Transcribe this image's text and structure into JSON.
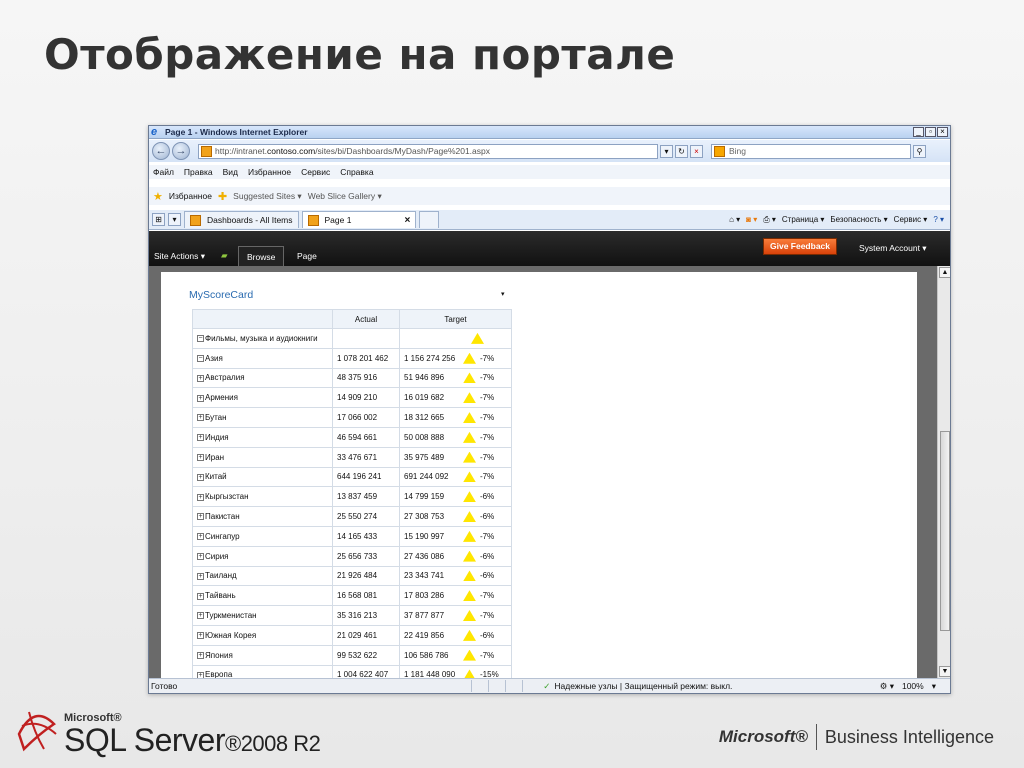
{
  "slide": {
    "title": "Отображение на портале"
  },
  "browser": {
    "window_title": "Page 1 - Windows Internet Explorer",
    "url_prefix": "http://intranet.",
    "url_domain": "contoso.com",
    "url_rest": "/sites/bi/Dashboards/MyDash/Page%201.aspx",
    "search_placeholder": "Bing",
    "menu": [
      "Файл",
      "Правка",
      "Вид",
      "Избранное",
      "Сервис",
      "Справка"
    ],
    "favorites_label": "Избранное",
    "favorites_links": [
      "Suggested Sites ▾",
      "Web Slice Gallery ▾"
    ],
    "tabs": [
      {
        "label": "Dashboards - All Items"
      },
      {
        "label": "Page 1"
      }
    ],
    "command_bar": [
      "Страница ▾",
      "Безопасность ▾",
      "Сервис ▾"
    ],
    "status_text": "Готово",
    "status_zone": "Надежные узлы | Защищенный режим: выкл.",
    "zoom": "100%"
  },
  "sharepoint": {
    "site_actions": "Site Actions ▾",
    "tab_browse": "Browse",
    "tab_page": "Page",
    "give_feedback": "Give Feedback",
    "system_account": "System Account ▾",
    "webpart_title": "MyScoreCard"
  },
  "scorecard": {
    "headers": [
      "",
      "Actual",
      "Target"
    ],
    "rows": [
      {
        "name": "Фильмы, музыка и аудиокниги",
        "actual": "",
        "target": "",
        "pct": "",
        "level": 1,
        "sign": "−"
      },
      {
        "name": "Азия",
        "actual": "1 078 201 462",
        "target": "1 156 274 256",
        "pct": "-7%",
        "level": 2,
        "sign": "−"
      },
      {
        "name": "Австралия",
        "actual": "48 375 916",
        "target": "51 946 896",
        "pct": "-7%",
        "level": 3,
        "sign": "+"
      },
      {
        "name": "Армения",
        "actual": "14 909 210",
        "target": "16 019 682",
        "pct": "-7%",
        "level": 3,
        "sign": "+"
      },
      {
        "name": "Бутан",
        "actual": "17 066 002",
        "target": "18 312 665",
        "pct": "-7%",
        "level": 3,
        "sign": "+"
      },
      {
        "name": "Индия",
        "actual": "46 594 661",
        "target": "50 008 888",
        "pct": "-7%",
        "level": 3,
        "sign": "+"
      },
      {
        "name": "Иран",
        "actual": "33 476 671",
        "target": "35 975 489",
        "pct": "-7%",
        "level": 3,
        "sign": "+"
      },
      {
        "name": "Китай",
        "actual": "644 196 241",
        "target": "691 244 092",
        "pct": "-7%",
        "level": 3,
        "sign": "+"
      },
      {
        "name": "Кыргызстан",
        "actual": "13 837 459",
        "target": "14 799 159",
        "pct": "-6%",
        "level": 3,
        "sign": "+"
      },
      {
        "name": "Пакистан",
        "actual": "25 550 274",
        "target": "27 308 753",
        "pct": "-6%",
        "level": 3,
        "sign": "+"
      },
      {
        "name": "Сингапур",
        "actual": "14 165 433",
        "target": "15 190 997",
        "pct": "-7%",
        "level": 3,
        "sign": "+"
      },
      {
        "name": "Сирия",
        "actual": "25 656 733",
        "target": "27 436 086",
        "pct": "-6%",
        "level": 3,
        "sign": "+"
      },
      {
        "name": "Таиланд",
        "actual": "21 926 484",
        "target": "23 343 741",
        "pct": "-6%",
        "level": 3,
        "sign": "+"
      },
      {
        "name": "Тайвань",
        "actual": "16 568 081",
        "target": "17 803 286",
        "pct": "-7%",
        "level": 3,
        "sign": "+"
      },
      {
        "name": "Туркменистан",
        "actual": "35 316 213",
        "target": "37 877 877",
        "pct": "-7%",
        "level": 3,
        "sign": "+"
      },
      {
        "name": "Южная Корея",
        "actual": "21 029 461",
        "target": "22 419 856",
        "pct": "-6%",
        "level": 3,
        "sign": "+"
      },
      {
        "name": "Япония",
        "actual": "99 532 622",
        "target": "106 586 786",
        "pct": "-7%",
        "level": 3,
        "sign": "+"
      },
      {
        "name": "Европа",
        "actual": "1 004 622 407",
        "target": "1 181 448 090",
        "pct": "-15%",
        "level": 2,
        "sign": "+"
      }
    ],
    "indicator_color": "#ffe600"
  },
  "branding": {
    "ms_small": "Microsoft®",
    "product": "SQL Server",
    "version": "®2008 R2",
    "ms_bold": "Microsoft®",
    "bi": "Business Intelligence"
  }
}
